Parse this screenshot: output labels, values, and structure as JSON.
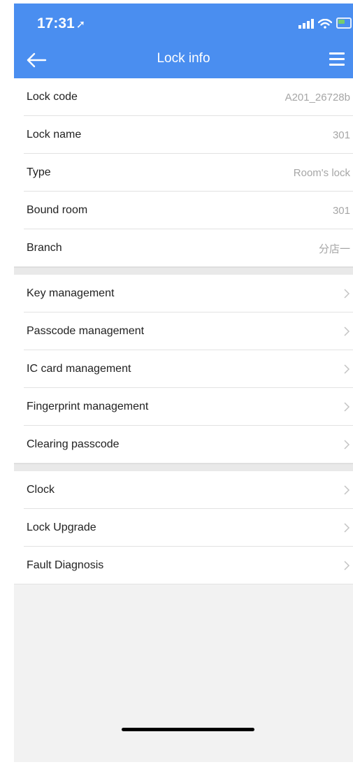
{
  "status_bar": {
    "time": "17:31",
    "location_glyph": "➚"
  },
  "nav": {
    "title": "Lock info"
  },
  "info_rows": [
    {
      "label": "Lock code",
      "value": "A201_26728b"
    },
    {
      "label": "Lock name",
      "value": "301"
    },
    {
      "label": "Type",
      "value": "Room's lock"
    },
    {
      "label": "Bound room",
      "value": "301"
    },
    {
      "label": "Branch",
      "value": "分店一"
    }
  ],
  "management_rows": [
    {
      "label": "Key management"
    },
    {
      "label": "Passcode management"
    },
    {
      "label": "IC card management"
    },
    {
      "label": "Fingerprint management"
    },
    {
      "label": "Clearing passcode"
    }
  ],
  "settings_rows": [
    {
      "label": "Clock"
    },
    {
      "label": "Lock Upgrade"
    },
    {
      "label": "Fault Diagnosis"
    }
  ],
  "colors": {
    "accent": "#4a8ef0",
    "background": "#f2f2f2"
  },
  "icons": {
    "back": "arrow-left-icon",
    "menu": "hamburger-menu-icon",
    "row": "chevron-right-icon"
  }
}
